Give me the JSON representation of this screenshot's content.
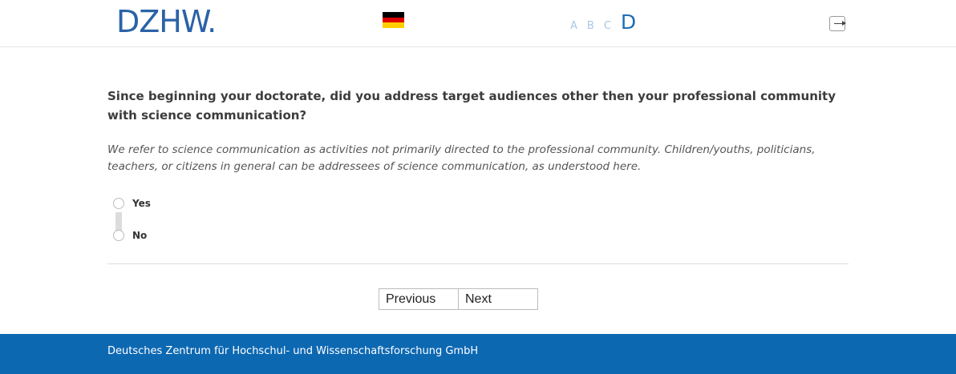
{
  "header": {
    "logo_text": "DZHW.",
    "language_flag_icon": "german-flag-icon",
    "font_sizes": [
      "A",
      "B",
      "C",
      "D"
    ],
    "logout_icon": "logout-icon"
  },
  "colors": {
    "brand_blue": "#2a62a8",
    "footer_blue": "#0d68b2",
    "font_switch_inactive": "#a9c6e6",
    "font_switch_active": "#1f6db8"
  },
  "question": {
    "text": "Since beginning your doctorate, did you address target audiences other then your professional community with science communication?",
    "instruction": "We refer to science communication as activities not primarily directed to the professional community. Children/youths, politicians, teachers, or citizens in general can be addressees of science communication, as understood here.",
    "options": [
      {
        "label": "Yes"
      },
      {
        "label": "No"
      }
    ]
  },
  "navigation": {
    "previous_label": "Previous",
    "next_label": "Next"
  },
  "footer": {
    "text": "Deutsches Zentrum für Hochschul- und Wissenschaftsforschung GmbH"
  }
}
